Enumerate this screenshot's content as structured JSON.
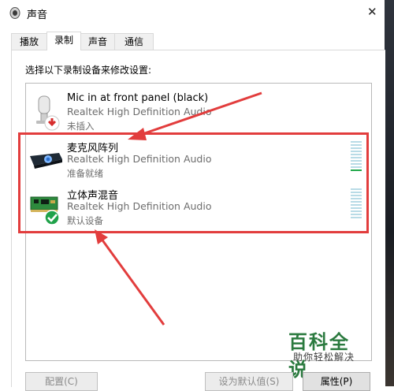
{
  "window": {
    "title": "声音",
    "close_glyph": "✕"
  },
  "tabs": [
    {
      "label": "播放",
      "active": false
    },
    {
      "label": "录制",
      "active": true
    },
    {
      "label": "声音",
      "active": false
    },
    {
      "label": "通信",
      "active": false
    }
  ],
  "instruction": "选择以下录制设备来修改设置:",
  "devices": [
    {
      "name": "Mic in at front panel (black)",
      "driver": "Realtek High Definition Audio",
      "status": "未插入",
      "icon": "microphone-unplugged-icon",
      "level": null
    },
    {
      "name": "麦克风阵列",
      "driver": "Realtek High Definition Audio",
      "status": "准备就绪",
      "icon": "microphone-array-icon",
      "level": 0.1
    },
    {
      "name": "立体声混音",
      "driver": "Realtek High Definition Audio",
      "status": "默认设备",
      "icon": "stereo-mix-board-icon",
      "level": 0
    }
  ],
  "buttons": {
    "configure": "配置(C)",
    "set_default": "设为默认值(S)",
    "properties": "属性(P)"
  },
  "watermark": {
    "title": "百科全说",
    "subtitle": "助你轻松解决"
  },
  "colors": {
    "annotation": "#e23d3d",
    "status_ok": "#21a84a",
    "meter_idle": "#b8dbe6"
  }
}
